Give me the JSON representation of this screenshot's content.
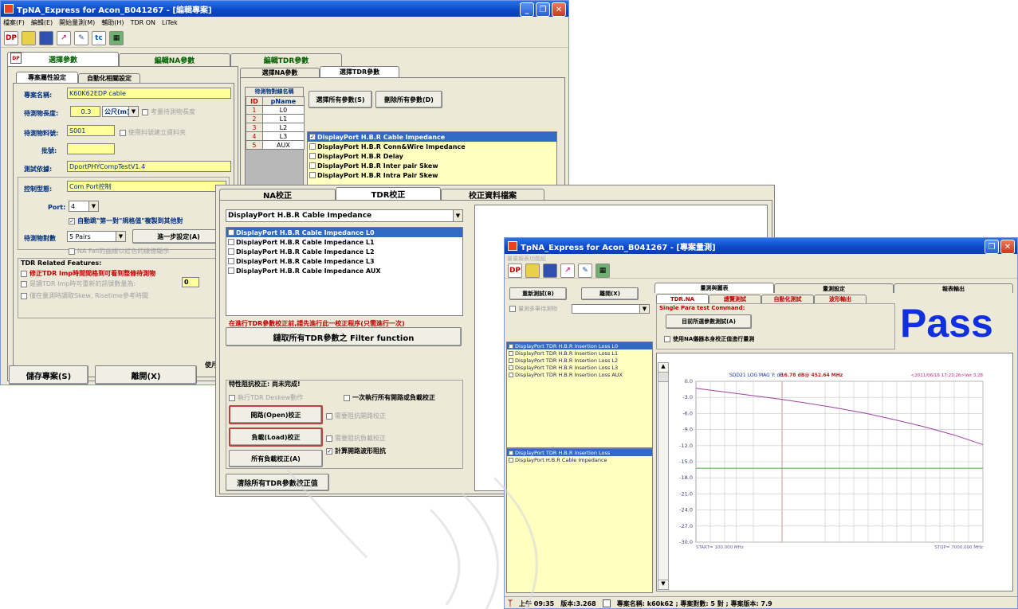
{
  "win1": {
    "title": "TpNA_Express for Acon_B041267 - [編輯專案]",
    "menu": [
      "檔案(F)",
      "編輯(E)",
      "開始量測(M)",
      "輔助(H)",
      "TDR ON",
      "LiTek"
    ],
    "toolbar_icons": [
      "dp-icon",
      "save-icon",
      "book-icon",
      "chart-icon",
      "edit-icon",
      "tc-icon",
      "grid-icon"
    ],
    "main_tabs": [
      "選擇參數",
      "編輯NA參數",
      "編輯TDR參數"
    ],
    "sub_tabs": [
      "專案屬性設定",
      "自動化相關設定"
    ],
    "project_name_label": "專案名稱:",
    "project_name": "K60K62EDP cable",
    "length_label": "待測物長度:",
    "length_value": "0.3",
    "length_unit": "公尺(m)",
    "consider_length": "考量待測物長度",
    "part_no_label": "待測物料號:",
    "part_no": "S001",
    "use_part_no": "使用料號建立資料夾",
    "lot_label": "批號:",
    "lot": "",
    "test_basis_label": "測試依據:",
    "test_basis": "DportPHYCompTestV1.4",
    "control_type_label": "控制型態:",
    "control_type": "Com Port控制",
    "port_label": "Port:",
    "port": "4",
    "auto_skip": "自動跳\"第一對\"規格值\"複製到其他對",
    "pairs_label": "待測物對數",
    "pairs": "5 Pairs",
    "advanced_button": "進一步設定(A)",
    "na_fail": "NA Fail的曲線以紅色的線條顯示",
    "tdr_features": "TDR Related Features:",
    "tdr_feat1": "修正TDR Imp時間間格到可看到整條待測物",
    "tdr_feat2": "是讀TDR Imp時可重新的訊號數量為:",
    "tdr_feat2_value": "0",
    "tdr_feat3": "僅在量測時讀取Skew, Risetime參考時間",
    "save_button": "儲存專案(S)",
    "exit_button": "離開(X)",
    "partial_label": "使月",
    "sel_tabs": [
      "選擇NA參數",
      "選擇TDR參數"
    ],
    "dut_table_title": "待測物對線名稱",
    "dut_table_headers": [
      "ID",
      "pName"
    ],
    "dut_rows": [
      [
        "1",
        "L0"
      ],
      [
        "2",
        "L1"
      ],
      [
        "3",
        "L2"
      ],
      [
        "4",
        "L3"
      ],
      [
        "5",
        "AUX"
      ]
    ],
    "select_all": "選擇所有參數(S)",
    "delete_all": "刪除所有參數(D)",
    "params": [
      {
        "label": "DisplayPort H.B.R Cable Impedance",
        "checked": true,
        "selected": true
      },
      {
        "label": "DisplayPort H.B.R Conn&Wire Impedance",
        "checked": false,
        "selected": false
      },
      {
        "label": "DisplayPort H.B.R Delay",
        "checked": false,
        "selected": false
      },
      {
        "label": "DisplayPort H.B.R Inter pair Skew",
        "checked": false,
        "selected": false
      },
      {
        "label": "DisplayPort H.B.R Intra Pair Skew",
        "checked": false,
        "selected": false
      }
    ]
  },
  "win2": {
    "tabs": [
      "NA校正",
      "TDR校正",
      "校正資料檔案"
    ],
    "dropdown": "DisplayPort H.B.R Cable Impedance",
    "items": [
      "DisplayPort H.B.R Cable Impedance L0",
      "DisplayPort H.B.R Cable Impedance L1",
      "DisplayPort H.B.R Cable Impedance L2",
      "DisplayPort H.B.R Cable Impedance L3",
      "DisplayPort H.B.R Cable Impedance AUX"
    ],
    "warning": "在進行TDR參數校正前,請先進行此一校正程序(只需進行一次)",
    "filter_button": "鏈取所有TDR參數之 Filter function",
    "char_status": "特性阻抗校正: 尚未完成!",
    "deskew": "執行TDR Deskew動作",
    "run_all": "一次執行所有開路或負載校正",
    "open_button": "開路(Open)校正",
    "open_need": "需要阻抗開路校正",
    "load_button": "負載(Load)校正",
    "load_need": "需要阻抗負載校正",
    "calc_open": "計算開路波形阻抗",
    "all_load_button": "所有負載校正(A)",
    "clear_button": "清除所有TDR參數校正值"
  },
  "win3": {
    "title": "TpNA_Express for Acon_B041267 - [專案量測]",
    "menu_ghost": "量量報表功能組",
    "new_test": "重新測試(B)",
    "exit": "離開(X)",
    "multi_dut": "量測多筆待測物",
    "top_tabs": [
      "量測與圖表",
      "量測設定",
      "報表輸出"
    ],
    "sub_tabs": [
      "TDR.NA",
      "總覽測試",
      "自動化測試",
      "波形輸出"
    ],
    "single_cmd": "Single Para test Command:",
    "test_selected": "目前所選參數測試(A)",
    "use_na": "使用NA儀器本身校正值進行量測",
    "result": "Pass",
    "result_color": "#1030e0",
    "list_top": [
      "DisplayPort TDR H.B.R Insertion Loss L0",
      "DisplayPort TDR H.B.R Insertion Loss L1",
      "DisplayPort TDR H.B.R Insertion Loss L2",
      "DisplayPort TDR H.B.R Insertion Loss L3",
      "DisplayPort TDR H.B.R Insertion Loss AUX"
    ],
    "list_bottom": [
      "DisplayPort TDR H.B.R Insertion Loss",
      "DisplayPort H.B.R Cable Impedance"
    ],
    "chart_header": "SDD21 LOG MAG   Y: dB",
    "marker_readout": "-16.78 dB@ 452.64 MHz",
    "timestamp": "<2011/06/16 17:23:26>Ver 3.28",
    "start_label": "START= 100.000 MHz",
    "stop_label": "STOP= 7000.000 MHz",
    "status_bar": {
      "time": "上午 09:35",
      "version": "版本:3.268",
      "project": "專案名稱: k60k62 ; 專案對數: 5 對 ; 專案版本: 7.9"
    }
  },
  "chart_data": {
    "type": "line",
    "title": "SDD21 LOG MAG",
    "ylabel": "dB",
    "xlabel": "",
    "xlim": [
      100,
      7000
    ],
    "ylim": [
      -30,
      0
    ],
    "y_ticks": [
      "0.0",
      "-3.0",
      "-6.0",
      "-9.0",
      "-12.0",
      "-15.0",
      "-18.0",
      "-21.0",
      "-24.0",
      "-27.0",
      "-30.0"
    ],
    "series": [
      {
        "color": "#a040a0",
        "x": [
          100,
          700,
          1400,
          2100,
          2800,
          3500,
          4200,
          4900,
          5600,
          6300,
          7000
        ],
        "values": [
          -1.3,
          -1.9,
          -2.6,
          -3.3,
          -4.1,
          -5.0,
          -6.0,
          -7.2,
          -8.5,
          -10.0,
          -11.8
        ]
      },
      {
        "color": "#40b040",
        "x": [
          100,
          7000
        ],
        "values": [
          -16.2,
          -16.2
        ]
      }
    ],
    "marker_x": 452.64,
    "marker_color": "#c02020"
  }
}
